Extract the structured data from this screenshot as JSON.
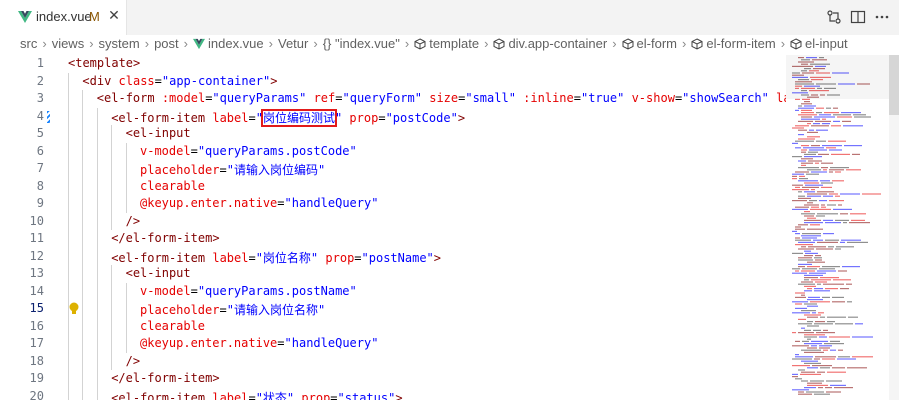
{
  "tab": {
    "filename": "index.vue",
    "modified": "M"
  },
  "breadcrumb": [
    "src",
    "views",
    "system",
    "post",
    "index.vue",
    "Vetur",
    "{} \"index.vue\"",
    "template",
    "div.app-container",
    "el-form",
    "el-form-item",
    "el-input"
  ],
  "lines": [
    {
      "num": "1",
      "indent": 0,
      "tokens": [
        [
          "t",
          "<template>"
        ]
      ]
    },
    {
      "num": "2",
      "indent": 1,
      "tokens": [
        [
          "t",
          "<div "
        ],
        [
          "a",
          "class"
        ],
        [
          "p",
          "="
        ],
        [
          "s",
          "\"app-container\""
        ],
        [
          "t",
          ">"
        ]
      ]
    },
    {
      "num": "3",
      "indent": 2,
      "tokens": [
        [
          "t",
          "<el-form "
        ],
        [
          "a",
          ":model"
        ],
        [
          "p",
          "="
        ],
        [
          "s",
          "\"queryParams\""
        ],
        [
          "p",
          " "
        ],
        [
          "a",
          "ref"
        ],
        [
          "p",
          "="
        ],
        [
          "s",
          "\"queryForm\""
        ],
        [
          "p",
          " "
        ],
        [
          "a",
          "size"
        ],
        [
          "p",
          "="
        ],
        [
          "s",
          "\"small\""
        ],
        [
          "p",
          " "
        ],
        [
          "a",
          ":inline"
        ],
        [
          "p",
          "="
        ],
        [
          "s",
          "\"true\""
        ],
        [
          "p",
          " "
        ],
        [
          "a",
          "v-show"
        ],
        [
          "p",
          "="
        ],
        [
          "s",
          "\"showSearch\""
        ],
        [
          "p",
          " "
        ],
        [
          "a",
          "label"
        ]
      ]
    },
    {
      "num": "4",
      "indent": 3,
      "tokens": [
        [
          "t",
          "<el-form-item "
        ],
        [
          "a",
          "label"
        ],
        [
          "p",
          "="
        ],
        [
          "s",
          "\""
        ],
        [
          "shl",
          "岗位编码测试"
        ],
        [
          "s",
          "\""
        ],
        [
          "p",
          " "
        ],
        [
          "a",
          "prop"
        ],
        [
          "p",
          "="
        ],
        [
          "s",
          "\"postCode\""
        ],
        [
          "t",
          ">"
        ]
      ]
    },
    {
      "num": "5",
      "indent": 4,
      "tokens": [
        [
          "t",
          "<el-input"
        ]
      ]
    },
    {
      "num": "6",
      "indent": 5,
      "tokens": [
        [
          "a",
          "v-model"
        ],
        [
          "p",
          "="
        ],
        [
          "s",
          "\"queryParams.postCode\""
        ]
      ]
    },
    {
      "num": "7",
      "indent": 5,
      "tokens": [
        [
          "a",
          "placeholder"
        ],
        [
          "p",
          "="
        ],
        [
          "s",
          "\"请输入岗位编码\""
        ]
      ]
    },
    {
      "num": "8",
      "indent": 5,
      "tokens": [
        [
          "a",
          "clearable"
        ]
      ]
    },
    {
      "num": "9",
      "indent": 5,
      "tokens": [
        [
          "a",
          "@keyup.enter.native"
        ],
        [
          "p",
          "="
        ],
        [
          "s",
          "\"handleQuery\""
        ]
      ]
    },
    {
      "num": "10",
      "indent": 4,
      "tokens": [
        [
          "t",
          "/>"
        ]
      ]
    },
    {
      "num": "11",
      "indent": 3,
      "tokens": [
        [
          "t",
          "</el-form-item>"
        ]
      ]
    },
    {
      "num": "12",
      "indent": 3,
      "tokens": [
        [
          "t",
          "<el-form-item "
        ],
        [
          "a",
          "label"
        ],
        [
          "p",
          "="
        ],
        [
          "s",
          "\"岗位名称\""
        ],
        [
          "p",
          " "
        ],
        [
          "a",
          "prop"
        ],
        [
          "p",
          "="
        ],
        [
          "s",
          "\"postName\""
        ],
        [
          "t",
          ">"
        ]
      ]
    },
    {
      "num": "13",
      "indent": 4,
      "tokens": [
        [
          "t",
          "<el-input"
        ]
      ]
    },
    {
      "num": "14",
      "indent": 5,
      "tokens": [
        [
          "a",
          "v-model"
        ],
        [
          "p",
          "="
        ],
        [
          "s",
          "\"queryParams.postName\""
        ]
      ]
    },
    {
      "num": "15",
      "indent": 5,
      "tokens": [
        [
          "a",
          "placeholder"
        ],
        [
          "p",
          "="
        ],
        [
          "s",
          "\"请输入岗位名称\""
        ]
      ]
    },
    {
      "num": "16",
      "indent": 5,
      "tokens": [
        [
          "a",
          "clearable"
        ]
      ]
    },
    {
      "num": "17",
      "indent": 5,
      "tokens": [
        [
          "a",
          "@keyup.enter.native"
        ],
        [
          "p",
          "="
        ],
        [
          "s",
          "\"handleQuery\""
        ]
      ]
    },
    {
      "num": "18",
      "indent": 4,
      "tokens": [
        [
          "t",
          "/>"
        ]
      ]
    },
    {
      "num": "19",
      "indent": 3,
      "tokens": [
        [
          "t",
          "</el-form-item>"
        ]
      ]
    },
    {
      "num": "20",
      "indent": 3,
      "tokens": [
        [
          "t",
          "<el-form-item "
        ],
        [
          "a",
          "label"
        ],
        [
          "p",
          "="
        ],
        [
          "s",
          "\"状态\""
        ],
        [
          "p",
          " "
        ],
        [
          "a",
          "prop"
        ],
        [
          "p",
          "="
        ],
        [
          "s",
          "\"status\""
        ],
        [
          "t",
          ">"
        ]
      ]
    }
  ],
  "current_line": "15",
  "colors": {
    "tag": "#800000",
    "attr": "#e50000",
    "string": "#0000ff",
    "highlight_box": "#e21a1a"
  }
}
